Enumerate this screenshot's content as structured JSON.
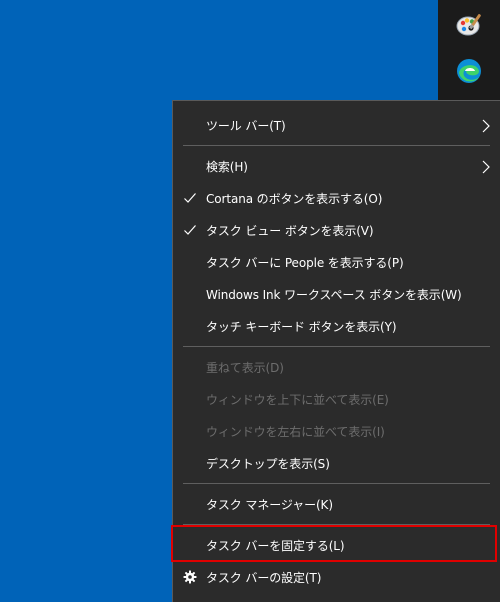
{
  "taskbar": {
    "icons": [
      "paint-icon",
      "edge-icon"
    ]
  },
  "menu": {
    "items": [
      {
        "label": "ツール バー(T)",
        "submenu": true
      },
      {
        "label": "検索(H)",
        "submenu": true
      },
      {
        "label": "Cortana のボタンを表示する(O)",
        "checked": true
      },
      {
        "label": "タスク ビュー ボタンを表示(V)",
        "checked": true
      },
      {
        "label": "タスク バーに People を表示する(P)"
      },
      {
        "label": "Windows Ink ワークスペース ボタンを表示(W)"
      },
      {
        "label": "タッチ キーボード ボタンを表示(Y)"
      },
      {
        "label": "重ねて表示(D)",
        "disabled": true
      },
      {
        "label": "ウィンドウを上下に並べて表示(E)",
        "disabled": true
      },
      {
        "label": "ウィンドウを左右に並べて表示(I)",
        "disabled": true
      },
      {
        "label": "デスクトップを表示(S)"
      },
      {
        "label": "タスク マネージャー(K)"
      },
      {
        "label": "タスク バーを固定する(L)",
        "highlighted": true
      },
      {
        "label": "タスク バーの設定(T)",
        "icon": "gear-icon"
      }
    ]
  },
  "colors": {
    "desktop": "#0063b8",
    "taskbar": "#1b1b1b",
    "menu_bg": "#2b2b2b",
    "text": "#ffffff",
    "disabled_text": "#6d6d6d",
    "separator": "#5f5f5f",
    "highlight_border": "#e00000"
  }
}
